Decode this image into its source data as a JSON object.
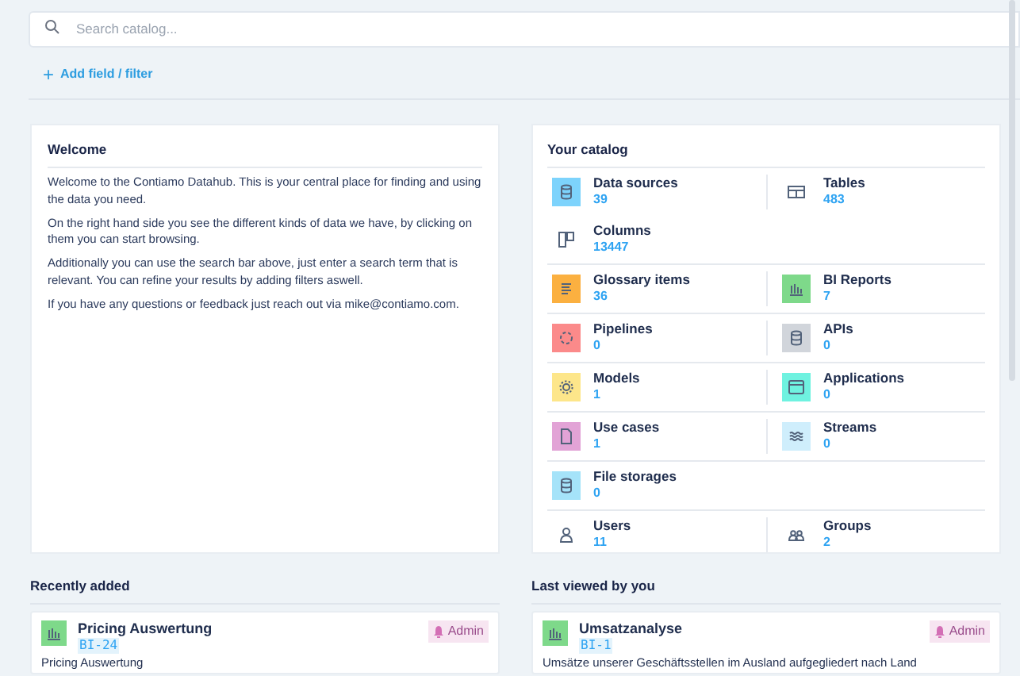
{
  "search": {
    "placeholder": "Search catalog..."
  },
  "add_filter": {
    "icon": "+",
    "label": "Add field / filter"
  },
  "welcome": {
    "title": "Welcome",
    "paragraphs": [
      "Welcome to the Contiamo Datahub. This is your central place for finding and using the data you need.",
      "On the right hand side you see the different kinds of data we have, by clicking on them you can start browsing.",
      "Additionally you can use the search bar above, just enter a search term that is relevant. You can refine your results by adding filters aswell.",
      "If you have any questions or feedback just reach out via mike@contiamo.com."
    ]
  },
  "catalog": {
    "title": "Your catalog",
    "groups": [
      [
        {
          "label": "Data sources",
          "count": "39",
          "kind": "tile",
          "color": "#7dd3fc"
        },
        {
          "label": "Tables",
          "count": "483",
          "kind": "plain"
        },
        {
          "label": "Columns",
          "count": "13447",
          "kind": "plain"
        }
      ],
      [
        {
          "label": "Glossary items",
          "count": "36",
          "kind": "tile",
          "color": "#fbb040"
        },
        {
          "label": "BI Reports",
          "count": "7",
          "kind": "tile",
          "color": "#7ed98a"
        }
      ],
      [
        {
          "label": "Pipelines",
          "count": "0",
          "kind": "tile",
          "color": "#fb8a8a"
        },
        {
          "label": "APIs",
          "count": "0",
          "kind": "tile",
          "color": "#d1d5db"
        }
      ],
      [
        {
          "label": "Models",
          "count": "1",
          "kind": "tile",
          "color": "#fde68a"
        },
        {
          "label": "Applications",
          "count": "0",
          "kind": "tile",
          "color": "#6ff2e0"
        }
      ],
      [
        {
          "label": "Use cases",
          "count": "1",
          "kind": "tile",
          "color": "#e2a3d6"
        },
        {
          "label": "Streams",
          "count": "0",
          "kind": "tile",
          "color": "#cfeefc"
        }
      ],
      [
        {
          "label": "File storages",
          "count": "0",
          "kind": "tile",
          "color": "#a5e3f9"
        }
      ],
      [
        {
          "label": "Users",
          "count": "11",
          "kind": "plain"
        },
        {
          "label": "Groups",
          "count": "2",
          "kind": "plain"
        }
      ]
    ]
  },
  "lists": [
    {
      "title": "Recently added",
      "item": {
        "name": "Pricing Auswertung",
        "code": "BI-24",
        "badge": "Admin",
        "description": "Pricing Auswertung"
      }
    },
    {
      "title": "Last viewed by you",
      "item": {
        "name": "Umsatzanalyse",
        "code": "BI-1",
        "badge": "Admin",
        "description": "Umsätze unserer Geschäftsstellen im Ausland aufgegliedert nach Land"
      }
    }
  ]
}
